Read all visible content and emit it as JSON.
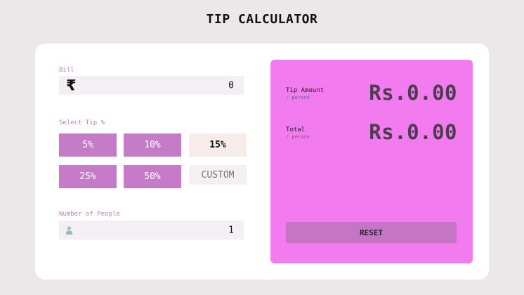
{
  "app": {
    "title": "TIP CALCULATOR"
  },
  "bill": {
    "label": "Bill",
    "currency_symbol": "₹",
    "value": "0"
  },
  "tip": {
    "label": "Select Tip %",
    "options": [
      "5%",
      "10%",
      "15%",
      "25%",
      "50%"
    ],
    "selected": "15%",
    "custom_label": "CUSTOM"
  },
  "people": {
    "label": "Number of People",
    "value": "1"
  },
  "results": {
    "tip_amount_label": "Tip Amount",
    "tip_amount_sub": "/ person",
    "tip_amount_value": "Rs.0.00",
    "total_label": "Total",
    "total_sub": "/ person",
    "total_value": "Rs.0.00",
    "reset_label": "RESET"
  },
  "colors": {
    "background": "#ece7e9",
    "card": "#ffffff",
    "accent_button": "#c57bc7",
    "result_panel": "#f17bef",
    "label": "#c07cbf"
  }
}
